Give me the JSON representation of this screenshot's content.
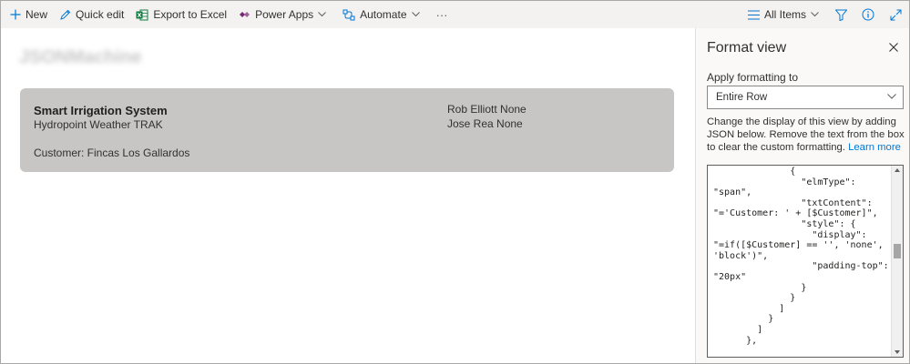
{
  "toolbar": {
    "new_label": "New",
    "quick_edit_label": "Quick edit",
    "export_label": "Export to Excel",
    "power_apps_label": "Power Apps",
    "automate_label": "Automate",
    "more_label": "···",
    "view_label": "All Items"
  },
  "list": {
    "blurred_title": "JSONMachine",
    "card": {
      "title": "Smart Irrigation System",
      "subtitle": "Hydropoint Weather TRAK",
      "customer": "Customer: Fincas Los Gallardos",
      "people_1": "Rob Elliott None",
      "people_2": "Jose Rea None"
    }
  },
  "panel": {
    "title": "Format view",
    "apply_label": "Apply formatting to",
    "apply_value": "Entire Row",
    "help_text": "Change the display of this view by adding JSON below. Remove the text from the box to clear the custom formatting.",
    "help_link": "Learn more",
    "json_content": "              {\n                \"elmType\":\n\"span\",\n                \"txtContent\":\n\"='Customer: ' + [$Customer]\",\n                \"style\": {\n                  \"display\":\n\"=if([$Customer] == '', 'none',\n'block')\",\n                  \"padding-top\":\n\"20px\"\n                }\n              }\n            ]\n          }\n        ]\n      },"
  },
  "colors": {
    "toolbar_bg": "#f3f2f1",
    "card_bg": "#c8c6c4",
    "accent": "#0078d4",
    "panel_bg": "#faf9f8"
  }
}
